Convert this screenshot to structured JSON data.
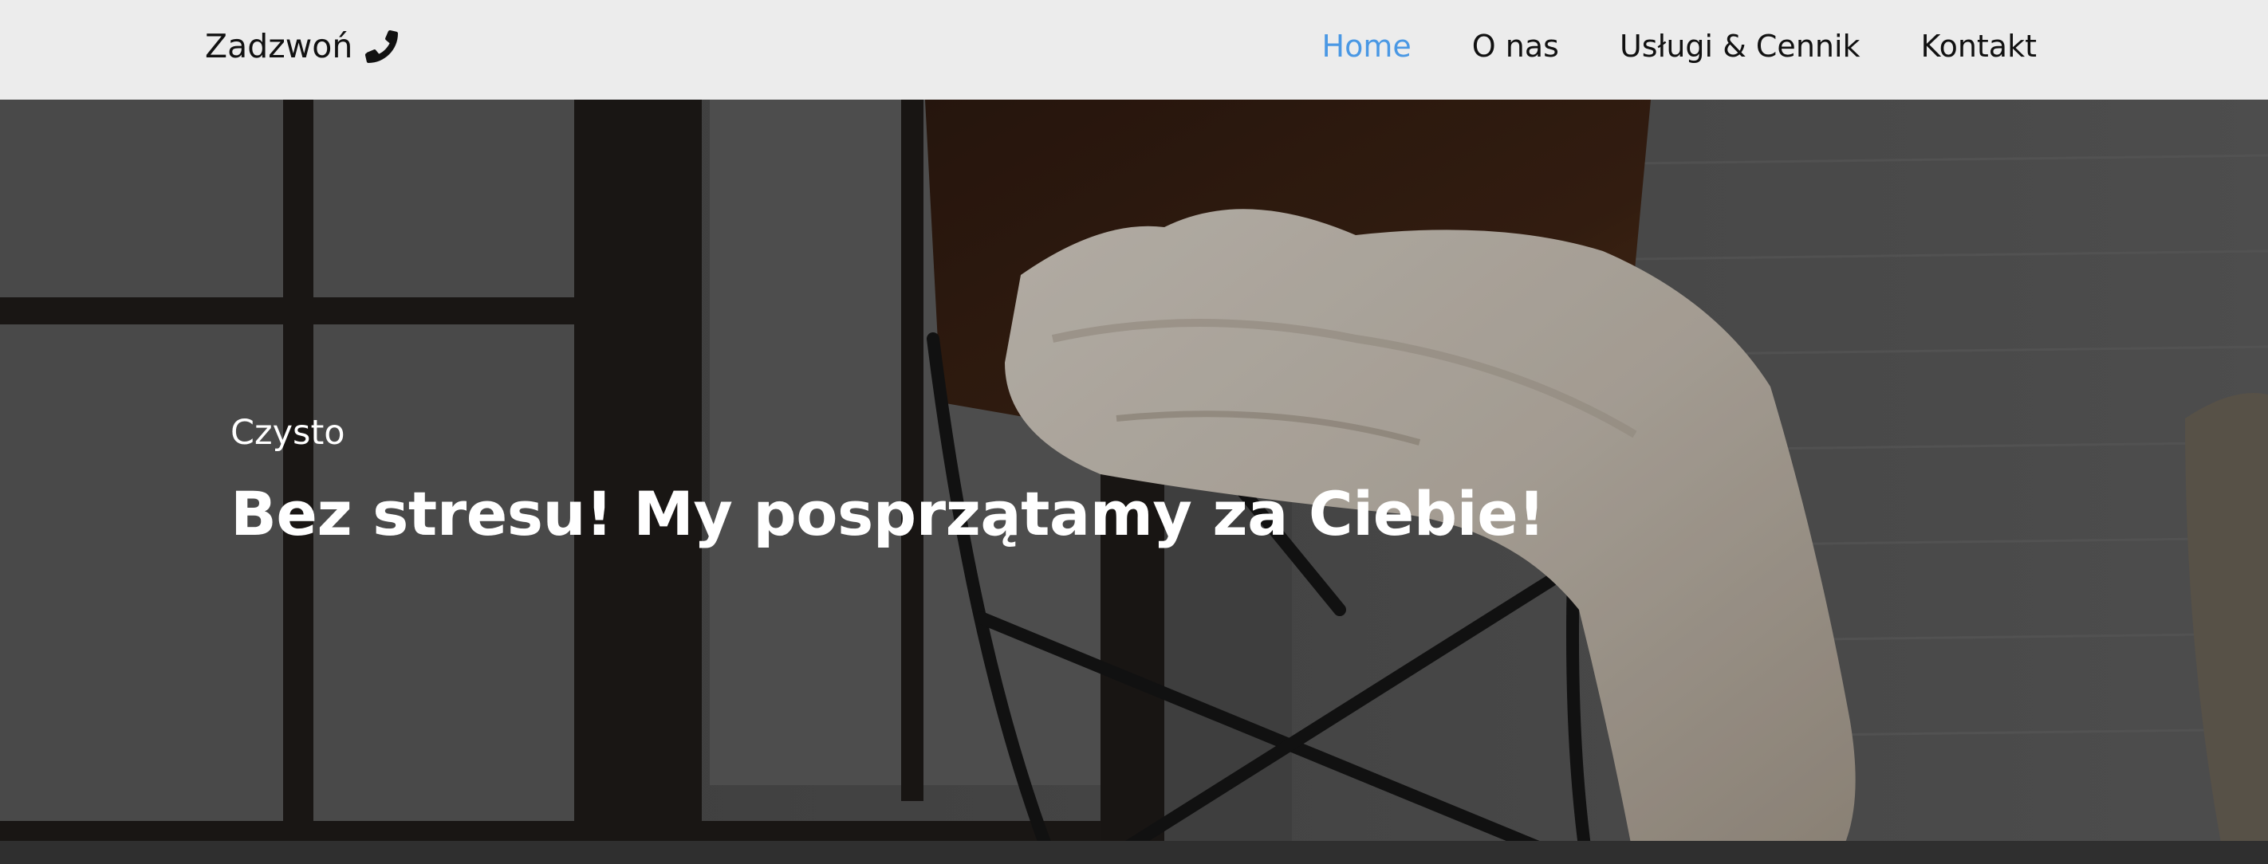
{
  "navbar": {
    "brand_label": "Zadzwoń",
    "brand_icon": "phone-icon",
    "links": [
      {
        "label": "Home",
        "active": true
      },
      {
        "label": "O nas",
        "active": false
      },
      {
        "label": "Usługi & Cennik",
        "active": false
      },
      {
        "label": "Kontakt",
        "active": false
      }
    ],
    "active_color": "#4a98e4"
  },
  "hero": {
    "eyebrow": "Czysto",
    "title": "Bez stresu! My posprzątamy za Ciebie!"
  }
}
